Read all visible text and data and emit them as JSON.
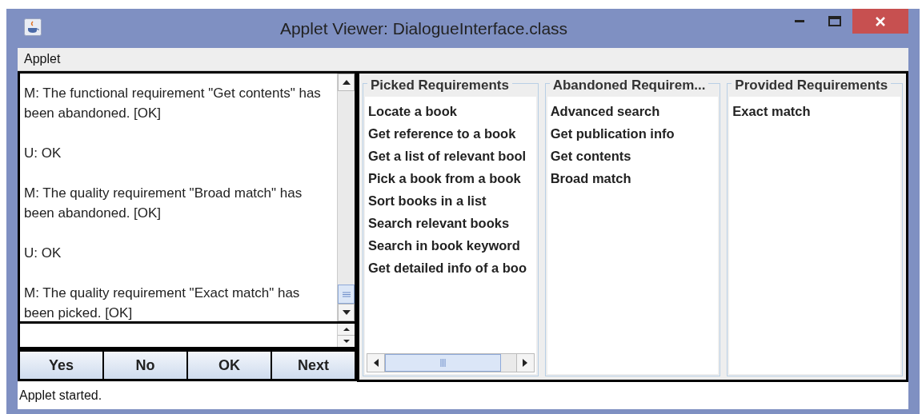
{
  "window": {
    "title": "Applet Viewer: DialogueInterface.class"
  },
  "menu_bar": [
    "Applet"
  ],
  "dialogue": {
    "messages": [
      {
        "text": "M: The functional requirement \"Get contents\" has been abandoned. [OK]"
      },
      {
        "text": "U: OK"
      },
      {
        "text": "M: The quality requirement \"Broad match\" has been abandoned. [OK]"
      },
      {
        "text": "U: OK"
      },
      {
        "text": "M: The quality requirement \"Exact match\" has been picked. [OK]"
      }
    ]
  },
  "buttons": [
    "Yes",
    "No",
    "OK",
    "Next"
  ],
  "panels": [
    {
      "title": "Picked Requirements",
      "items": [
        "Locate a book",
        "Get reference to a book",
        "Get a list of relevant bool",
        "Pick a book from a book",
        "Sort books in a list",
        "Search relevant books",
        "Search in book keyword",
        "Get detailed info of a boo"
      ],
      "horizontal_scroll": true
    },
    {
      "title": "Abandoned Requirem...",
      "items": [
        "Advanced search",
        "Get publication info",
        "Get contents",
        "Broad match"
      ],
      "horizontal_scroll": false
    },
    {
      "title": "Provided Requirements",
      "items": [
        "Exact match"
      ],
      "horizontal_scroll": false
    }
  ],
  "status_bar": "Applet started."
}
